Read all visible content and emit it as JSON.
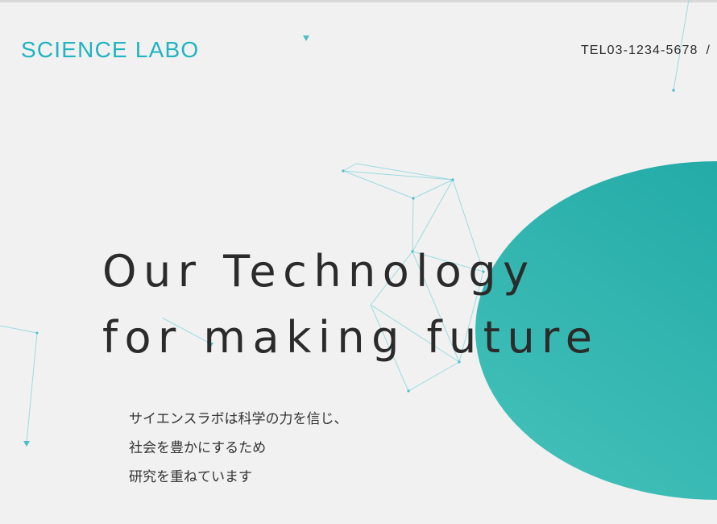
{
  "brand": {
    "name": "SCIENCE LABO"
  },
  "header": {
    "phone_label": "TEL03-1234-5678",
    "separator": "/"
  },
  "hero": {
    "line1": "Our Technology",
    "line2": "for making future"
  },
  "intro": {
    "lines": [
      "サイエンスラボは科学の力を信じ、",
      "社会を豊かにするため",
      "研究を重ねています"
    ]
  },
  "colors": {
    "accent": "#1fb4bf",
    "blob_start": "#46c2ba",
    "blob_end": "#18a3a2",
    "background": "#f1f1f1"
  }
}
